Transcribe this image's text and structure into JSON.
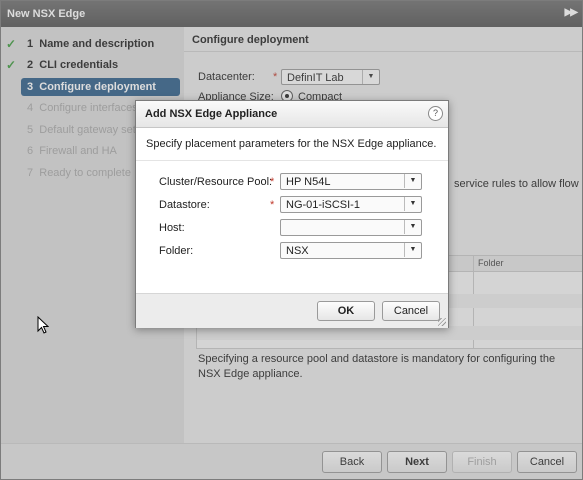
{
  "window": {
    "title": "New NSX Edge"
  },
  "steps": [
    {
      "number": "1",
      "label": "Name and description",
      "state": "done"
    },
    {
      "number": "2",
      "label": "CLI credentials",
      "state": "done"
    },
    {
      "number": "3",
      "label": "Configure deployment",
      "state": "active"
    },
    {
      "number": "4",
      "label": "Configure interfaces",
      "state": "todo"
    },
    {
      "number": "5",
      "label": "Default gateway setti",
      "state": "todo"
    },
    {
      "number": "6",
      "label": "Firewall and HA",
      "state": "todo"
    },
    {
      "number": "7",
      "label": "Ready to complete",
      "state": "todo"
    }
  ],
  "content": {
    "header": "Configure deployment",
    "datacenter_label": "Datacenter:",
    "datacenter_value": "DefinIT Lab",
    "appliance_size_label": "Appliance Size:",
    "appliance_size_value": "Compact",
    "partial_text": "service rules to allow flow",
    "grid_header_folder": "Folder",
    "note": "Specifying a resource pool and datastore is mandatory for configuring the NSX Edge appliance."
  },
  "footer": {
    "back": "Back",
    "next": "Next",
    "finish": "Finish",
    "cancel": "Cancel"
  },
  "dialog": {
    "title": "Add NSX Edge Appliance",
    "help": "?",
    "description": "Specify placement parameters for the NSX Edge appliance.",
    "fields": {
      "cluster_label": "Cluster/Resource Pool:",
      "cluster_value": "HP N54L",
      "datastore_label": "Datastore:",
      "datastore_value": "NG-01-iSCSI-1",
      "host_label": "Host:",
      "host_value": "",
      "folder_label": "Folder:",
      "folder_value": "NSX"
    },
    "required_mark": "*",
    "ok": "OK",
    "cancel": "Cancel"
  },
  "colors": {
    "active_step": "#2f5f8a",
    "check": "#3b9a3b",
    "required": "#c0392b"
  },
  "icons": {
    "check": "check-icon",
    "dropdown": "chevron-down-icon",
    "help": "help-icon",
    "expand": "expand-icon",
    "cursor": "mouse-cursor-icon"
  }
}
